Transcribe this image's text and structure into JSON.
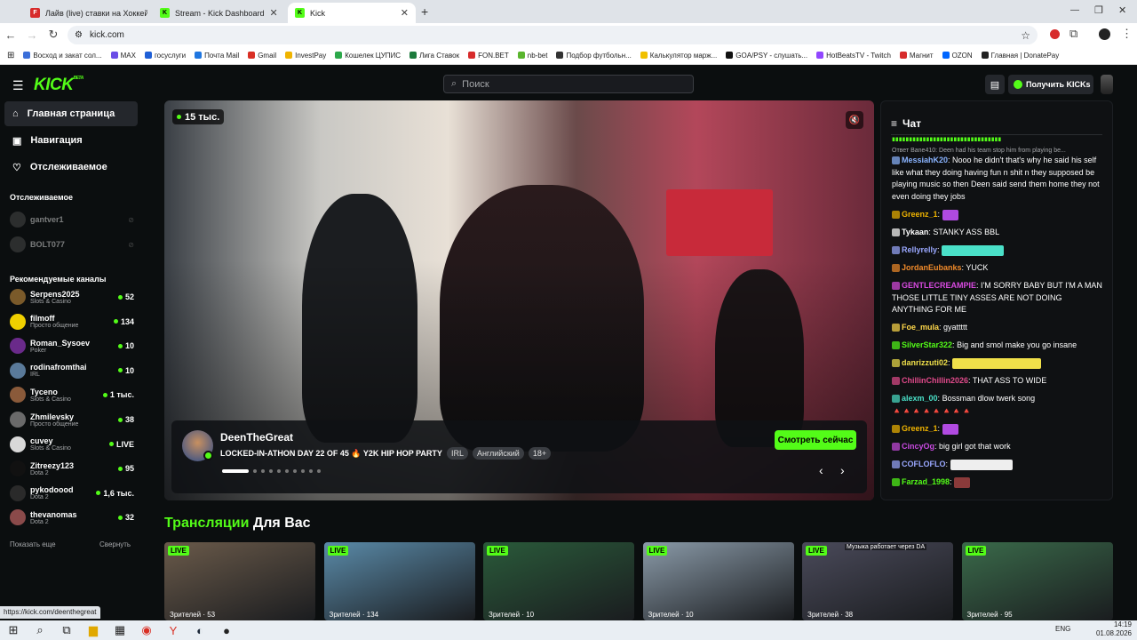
{
  "browser": {
    "tabs": [
      {
        "title": "Лайв (live) ставки на Хоккей о",
        "color": "#d72b2b",
        "icon": "F"
      },
      {
        "title": "Stream - Kick Dashboard",
        "color": "#53fc18",
        "icon": "K"
      },
      {
        "title": "Kick",
        "color": "#53fc18",
        "icon": "K"
      }
    ],
    "new_tab": "+",
    "address": "kick.com",
    "bookmarks": [
      {
        "label": "Восход и закат сол...",
        "color": "#3b6fd9"
      },
      {
        "label": "MAX",
        "color": "#6b4de6"
      },
      {
        "label": "госуслуги",
        "color": "#1f5fd6"
      },
      {
        "label": "Почта Mail",
        "color": "#1f76e0"
      },
      {
        "label": "Gmail",
        "color": "#d93025"
      },
      {
        "label": "InvestPay",
        "color": "#f0b400"
      },
      {
        "label": "Кошелек ЦУПИС",
        "color": "#2ca84a"
      },
      {
        "label": "Лига Ставок",
        "color": "#1c7a3c"
      },
      {
        "label": "FON.BET",
        "color": "#d72b2b"
      },
      {
        "label": "nb-bet",
        "color": "#5ab52e"
      },
      {
        "label": "Подбор футбольн...",
        "color": "#333333"
      },
      {
        "label": "Калькулятор марж...",
        "color": "#f0c000"
      },
      {
        "label": "GOA/PSY - слушать...",
        "color": "#111111"
      },
      {
        "label": "HotBeatsTV - Twitch",
        "color": "#9146ff"
      },
      {
        "label": "Магнит",
        "color": "#d72b2b"
      },
      {
        "label": "OZON",
        "color": "#0066ff"
      },
      {
        "label": "Главная | DonatePay",
        "color": "#222222"
      }
    ]
  },
  "header": {
    "logo": "KICK",
    "logo_badge": "BETA",
    "search_placeholder": "Поиск",
    "get_kicks": "Получить KICKs"
  },
  "sidebar": {
    "nav": [
      {
        "label": "Главная страница",
        "icon": "home-icon"
      },
      {
        "label": "Навигация",
        "icon": "browse-icon"
      },
      {
        "label": "Отслеживаемое",
        "icon": "heart-icon"
      }
    ],
    "following_title": "Отслеживаемое",
    "following": [
      {
        "name": "gantver1"
      },
      {
        "name": "BOLT077"
      }
    ],
    "recommended_title": "Рекомендуемые каналы",
    "recommended": [
      {
        "name": "Serpens2025",
        "category": "Slots & Casino",
        "viewers": "52",
        "color": "#7a5a2a"
      },
      {
        "name": "filmoff",
        "category": "Просто общение",
        "viewers": "134",
        "color": "#f0d000"
      },
      {
        "name": "Roman_Sysoev",
        "category": "Poker",
        "viewers": "10",
        "color": "#6a2a8a"
      },
      {
        "name": "rodinafromthai",
        "category": "IRL",
        "viewers": "10",
        "color": "#5a7a9a"
      },
      {
        "name": "Tyceno",
        "category": "Slots & Casino",
        "viewers": "1 тыс.",
        "color": "#8a5a3a"
      },
      {
        "name": "Zhmilevsky",
        "category": "Просто общение",
        "viewers": "38",
        "color": "#6a6a6a"
      },
      {
        "name": "cuvey",
        "category": "Slots & Casino",
        "viewers": "LIVE",
        "color": "#d8d8d8"
      },
      {
        "name": "Zitreezy123",
        "category": "Dota 2",
        "viewers": "95",
        "color": "#111111"
      },
      {
        "name": "pykodoood",
        "category": "Dota 2",
        "viewers": "1,6 тыс.",
        "color": "#2a2a2a"
      },
      {
        "name": "thevanomas",
        "category": "Dota 2",
        "viewers": "32",
        "color": "#8a4a4a"
      }
    ],
    "show_more": "Показать еще",
    "collapse": "Свернуть"
  },
  "hero": {
    "viewers": "15 тыс.",
    "streamer": "DeenTheGreat",
    "title": "LOCKED-IN-ATHON DAY 22 OF 45 🔥 Y2K HIP HOP PARTY",
    "tags": [
      "IRL",
      "Английский",
      "18+"
    ],
    "watch_button": "Смотреть сейчас",
    "slide_count": 10,
    "active_slide": 1
  },
  "chat": {
    "title": "Чат",
    "reply_note": "Ответ Bane410: Deen had his team stop him from playing be...",
    "messages": [
      {
        "user": "MessiahK20",
        "color": "#8ab4ff",
        "text": "Nooo he didn't that's why he said his self like what they doing having fun n shit n they supposed be playing music so then Deen said send them home they not even doing they jobs"
      },
      {
        "user": "Greenz_1",
        "color": "#f0b400",
        "text": ""
      },
      {
        "user": "Tykaan",
        "color": "#ffffff",
        "text": "STANKY ASS BBL"
      },
      {
        "user": "Rellyrelly",
        "color": "#9aa8ff",
        "text": ""
      },
      {
        "user": "JordanEubanks",
        "color": "#f08a2a",
        "text": "YUCK"
      },
      {
        "user": "GENTLECREAMPIE",
        "color": "#d84ae0",
        "text": "I'M SORRY BABY BUT I'M A MAN THOSE LITTLE TINY ASSES ARE NOT DOING ANYTHING FOR ME"
      },
      {
        "user": "Foe_mula",
        "color": "#ffd84a",
        "text": "gyattttt"
      },
      {
        "user": "SilverStar322",
        "color": "#53fc18",
        "text": "Big and smol make you go insane"
      },
      {
        "user": "danrizzuti02",
        "color": "#f0e04a",
        "text": ""
      },
      {
        "user": "ChillinChillin2026",
        "color": "#e04a8a",
        "text": "THAT ASS TO WIDE"
      },
      {
        "user": "alexm_00",
        "color": "#4ae0c8",
        "text": "Bossman dlow twerk song 🔺🔺🔺🔺🔺🔺🔺🔺"
      },
      {
        "user": "Greenz_1",
        "color": "#f0b400",
        "text": ""
      },
      {
        "user": "CincyOg",
        "color": "#c84ae0",
        "text": "big girl got that work"
      },
      {
        "user": "COFLOFLO",
        "color": "#9aa8ff",
        "text": ""
      },
      {
        "user": "Farzad_1998",
        "color": "#53fc18",
        "text": ""
      }
    ]
  },
  "streams_section": {
    "title_accent": "Трансляции",
    "title_rest": "Для Вас",
    "live_label": "LIVE",
    "cards": [
      {
        "caption": "Зрителей · 53",
        "bg": "#6a5a4a"
      },
      {
        "caption": "Зрителей · 134",
        "bg": "#5a8aa8"
      },
      {
        "caption": "Зрителей · 10",
        "bg": "#2a5a3a"
      },
      {
        "caption": "Зрителей · 10",
        "bg": "#8a9aa8"
      },
      {
        "caption": "Зрителей · 38",
        "bg": "#4a4a5a",
        "overlay": "Музыка работает через DA"
      },
      {
        "caption": "Зрителей · 95",
        "bg": "#3a6a4a"
      }
    ]
  },
  "status_url": "https://kick.com/deenthegreat",
  "taskbar": {
    "lang": "ENG",
    "time": "14:19",
    "date": "01.08.2026"
  }
}
